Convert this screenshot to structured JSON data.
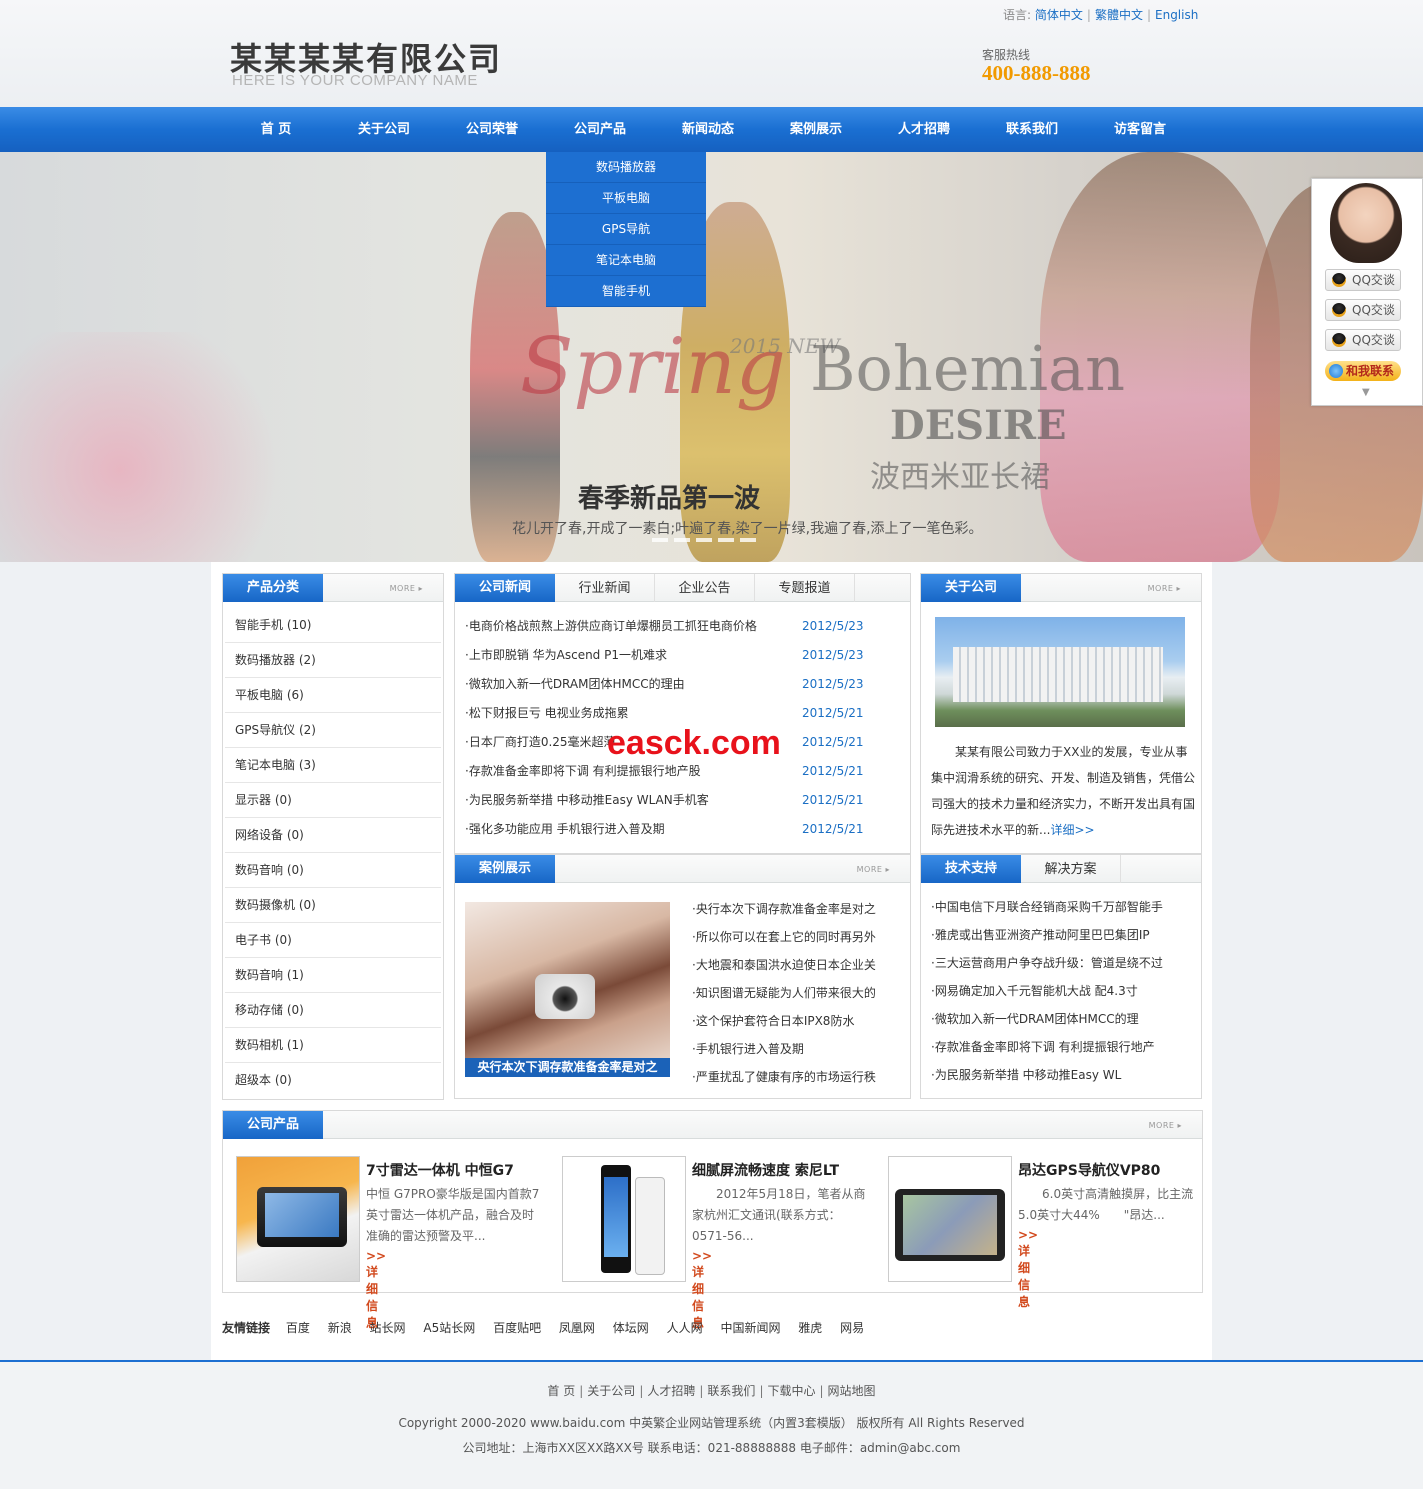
{
  "header": {
    "company_cn": "某某某某有限公司",
    "company_en": "HERE IS YOUR COMPANY NAME",
    "lang_label": "语言:",
    "langs": [
      "简体中文",
      "繁體中文",
      "English"
    ],
    "hotline_label": "客服热线",
    "hotline": "400-888-888"
  },
  "nav": {
    "items": [
      "首 页",
      "关于公司",
      "公司荣誉",
      "公司产品",
      "新闻动态",
      "案例展示",
      "人才招聘",
      "联系我们",
      "访客留言"
    ],
    "dropdown": [
      "数码播放器",
      "平板电脑",
      "GPS导航",
      "笔记本电脑",
      "智能手机"
    ]
  },
  "banner": {
    "script": "Spring",
    "year": "2015 NEW",
    "bohemian": "Bohemian",
    "desire": "DESIRE",
    "bohemian_cn": "波西米亚长裙",
    "title": "春季新品第一波",
    "subtitle": "花儿开了春,开成了一素白;叶遍了春,染了一片绿,我遍了春,添上了一笔色彩。"
  },
  "qq": {
    "buttons": [
      "QQ交谈",
      "QQ交谈",
      "QQ交谈"
    ],
    "contact": "和我联系"
  },
  "more_label": "MORE ▸",
  "categories": {
    "title": "产品分类",
    "items": [
      "智能手机 (10)",
      "数码播放器 (2)",
      "平板电脑 (6)",
      "GPS导航仪 (2)",
      "笔记本电脑 (3)",
      "显示器 (0)",
      "网络设备 (0)",
      "数码音响 (0)",
      "数码摄像机 (0)",
      "电子书 (0)",
      "数码音响 (1)",
      "移动存储 (0)",
      "数码相机 (1)",
      "超级本 (0)"
    ]
  },
  "news": {
    "tabs": [
      "公司新闻",
      "行业新闻",
      "企业公告",
      "专题报道"
    ],
    "items": [
      {
        "title": "·电商价格战煎熬上游供应商订单爆棚员工抓狂电商价格",
        "date": "2012/5/23"
      },
      {
        "title": "·上市即脱销 华为Ascend P1一机难求",
        "date": "2012/5/23"
      },
      {
        "title": "·微软加入新一代DRAM团体HMCC的理由",
        "date": "2012/5/23"
      },
      {
        "title": "·松下财报巨亏 电视业务成拖累",
        "date": "2012/5/21"
      },
      {
        "title": "·日本厂商打造0.25毫米超薄",
        "date": "2012/5/21"
      },
      {
        "title": "·存款准备金率即将下调 有利提振银行地产股",
        "date": "2012/5/21"
      },
      {
        "title": "·为民服务新举措 中移动推Easy WLAN手机客",
        "date": "2012/5/21"
      },
      {
        "title": "·强化多功能应用 手机银行进入普及期",
        "date": "2012/5/21"
      }
    ]
  },
  "about": {
    "title": "关于公司",
    "text": "　　某某有限公司致力于XX业的发展，专业从事集中润滑系统的研究、开发、制造及销售，凭借公司强大的技术力量和经济实力，不断开发出具有国际先进技术水平的新...",
    "detail": "详细>>"
  },
  "cases": {
    "title": "案例展示",
    "caption": "央行本次下调存款准备金率是对之",
    "items": [
      "·央行本次下调存款准备金率是对之",
      "·所以你可以在套上它的同时再另外",
      "·大地震和泰国洪水迫使日本企业关",
      "·知识图谱无疑能为人们带来很大的",
      "·这个保护套符合日本IPX8防水",
      "·手机银行进入普及期",
      "·严重扰乱了健康有序的市场运行秩"
    ]
  },
  "tech": {
    "tabs": [
      "技术支持",
      "解决方案"
    ],
    "items": [
      "·中国电信下月联合经销商采购千万部智能手",
      "·雅虎或出售亚洲资产推动阿里巴巴集团IP",
      "·三大运营商用户争夺战升级：管道是绕不过",
      "·网易确定加入千元智能机大战 配4.3寸",
      "·微软加入新一代DRAM团体HMCC的理",
      "·存款准备金率即将下调 有利提振银行地产",
      "·为民服务新举措 中移动推Easy WL"
    ]
  },
  "products": {
    "title": "公司产品",
    "items": [
      {
        "name": "7寸雷达一体机 中恒G7",
        "desc": "中恒 G7PRO豪华版是国内首款7英寸雷达一体机产品，融合及时准确的雷达预警及平...",
        "more": ">>详细信息"
      },
      {
        "name": "细腻屏流畅速度 索尼LT",
        "desc": "　　2012年5月18日，笔者从商家杭州汇文通讯(联系方式：0571-56...",
        "more": ">>详细信息"
      },
      {
        "name": "昂达GPS导航仪VP80",
        "desc": "　　6.0英寸高清触摸屏，比主流5.0英寸大44%　　\"昂达...",
        "more": ">>详细信息"
      }
    ]
  },
  "links": {
    "label": "友情链接",
    "items": [
      "百度",
      "新浪",
      "站长网",
      "A5站长网",
      "百度贴吧",
      "凤凰网",
      "体坛网",
      "人人网",
      "中国新闻网",
      "雅虎",
      "网易"
    ]
  },
  "footer": {
    "nav": [
      "首 页",
      "关于公司",
      "人才招聘",
      "联系我们",
      "下载中心",
      "网站地图"
    ],
    "copyright": "Copyright 2000-2020 www.baidu.com 中英繁企业网站管理系统（内置3套模版） 版权所有 All Rights Reserved",
    "address": "公司地址：上海市XX区XX路XX号 联系电话：021-88888888 电子邮件：admin@abc.com"
  },
  "watermark": "easck.com"
}
